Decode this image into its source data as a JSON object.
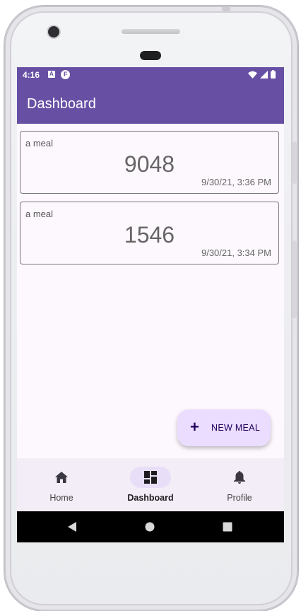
{
  "status_bar": {
    "time": "4:16",
    "icon_a": "A",
    "icon_f": "F"
  },
  "app_bar": {
    "title": "Dashboard"
  },
  "meals": [
    {
      "title": "a meal",
      "value": "9048",
      "date": "9/30/21, 3:36 PM"
    },
    {
      "title": "a meal",
      "value": "1546",
      "date": "9/30/21, 3:34 PM"
    }
  ],
  "fab": {
    "icon": "+",
    "label": "NEW MEAL"
  },
  "bottom_nav": [
    {
      "label": "Home",
      "icon": "home-icon",
      "active": false
    },
    {
      "label": "Dashboard",
      "icon": "dashboard-icon",
      "active": true
    },
    {
      "label": "Profile",
      "icon": "bell-icon",
      "active": false
    }
  ],
  "colors": {
    "primary": "#6750a4",
    "fab_container": "#eaddff",
    "nav_indicator": "#e8def8",
    "nav_background": "#f3edf7"
  }
}
